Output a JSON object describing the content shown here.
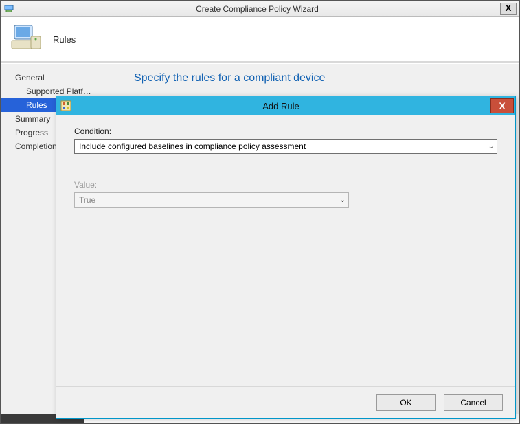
{
  "wizard": {
    "title": "Create Compliance Policy Wizard",
    "page_header": "Rules",
    "close_glyph": "X"
  },
  "nav": {
    "items": [
      {
        "label": "General",
        "indent": false,
        "selected": false
      },
      {
        "label": "Supported Platf…",
        "indent": true,
        "selected": false
      },
      {
        "label": "Rules",
        "indent": true,
        "selected": true
      },
      {
        "label": "Summary",
        "indent": false,
        "selected": false
      },
      {
        "label": "Progress",
        "indent": false,
        "selected": false
      },
      {
        "label": "Completion",
        "indent": false,
        "selected": false
      }
    ]
  },
  "content": {
    "heading": "Specify the rules for a compliant device"
  },
  "modal": {
    "title": "Add Rule",
    "close_glyph": "X",
    "condition_label": "Condition:",
    "condition_value": "Include configured baselines in compliance policy assessment",
    "value_label": "Value:",
    "value_value": "True",
    "ok_label": "OK",
    "cancel_label": "Cancel"
  }
}
